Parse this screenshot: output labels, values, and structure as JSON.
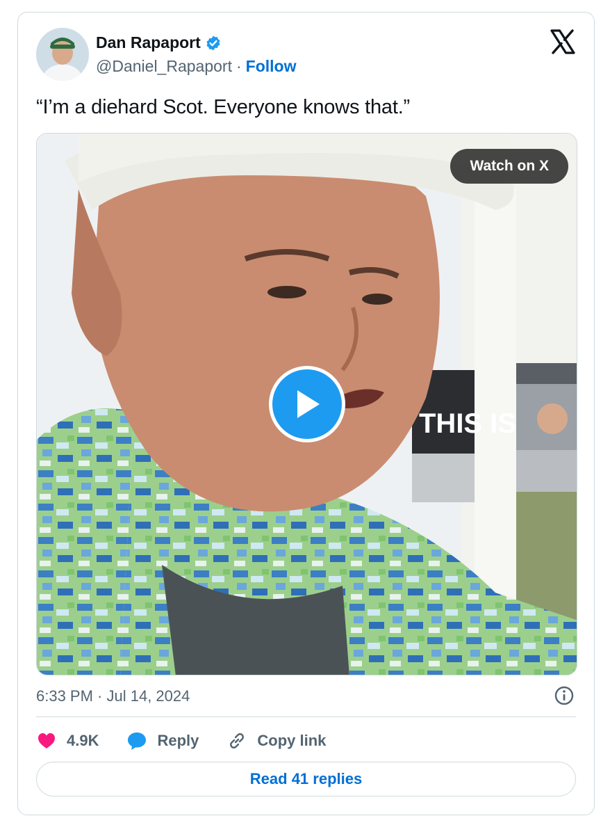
{
  "author": {
    "name": "Dan Rapaport",
    "handle": "@Daniel_Rapaport",
    "separator": "·",
    "follow_label": "Follow"
  },
  "tweet": {
    "text": "“I’m a diehard Scot. Everyone knows that.”"
  },
  "media": {
    "watch_label": "Watch on X",
    "sign_text": "THIS IS"
  },
  "meta": {
    "timestamp": "6:33 PM · Jul 14, 2024"
  },
  "actions": {
    "likes_count": "4.9K",
    "reply_label": "Reply",
    "copy_label": "Copy link"
  },
  "footer": {
    "read_replies_label": "Read 41 replies"
  },
  "colors": {
    "accent": "#1d9bf0",
    "link": "#006fd6",
    "like": "#f91880",
    "secondary_text": "#536471",
    "border": "#cfd9de"
  },
  "icons": [
    "verified-badge-icon",
    "x-logo-icon",
    "play-icon",
    "info-icon",
    "heart-icon",
    "reply-bubble-icon",
    "link-icon"
  ]
}
